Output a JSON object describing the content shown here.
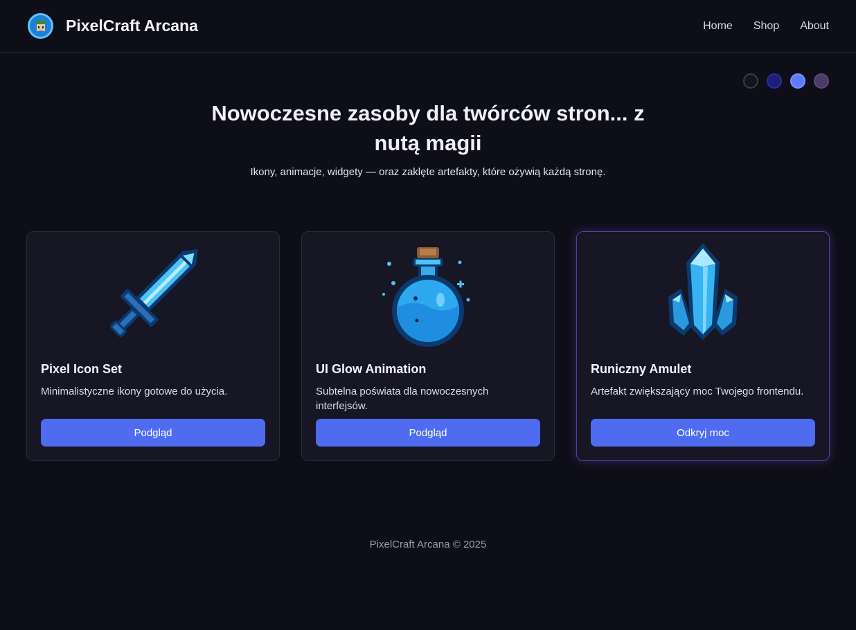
{
  "header": {
    "brand": "PixelCraft Arcana",
    "logo_icon": "pixel-character-icon",
    "nav": [
      {
        "label": "Home"
      },
      {
        "label": "Shop"
      },
      {
        "label": "About"
      }
    ]
  },
  "theme_swatches": [
    "#14141e",
    "#1b1f7a",
    "#5b7cff",
    "#4a3a66"
  ],
  "hero": {
    "title": "Nowoczesne zasoby dla twórców stron... z nutą magii",
    "subtitle": "Ikony, animacje, widgety — oraz zaklęte artefakty, które ożywią każdą stronę."
  },
  "cards": [
    {
      "icon": "pixel-sword-icon",
      "title": "Pixel Icon Set",
      "description": "Minimalistyczne ikony gotowe do użycia.",
      "button": "Podgląd"
    },
    {
      "icon": "potion-flask-icon",
      "title": "UI Glow Animation",
      "description": "Subtelna poświata dla nowoczesnych interfejsów.",
      "button": "Podgląd"
    },
    {
      "icon": "crystal-icon",
      "title": "Runiczny Amulet",
      "description": "Artefakt zwiększający moc Twojego frontendu.",
      "button": "Odkryj moc"
    }
  ],
  "footer": "PixelCraft Arcana © 2025",
  "colors": {
    "background": "#0e0e18",
    "card": "#161624",
    "accent": "#4f6cf0",
    "glow_border": "#5a3fa8"
  }
}
